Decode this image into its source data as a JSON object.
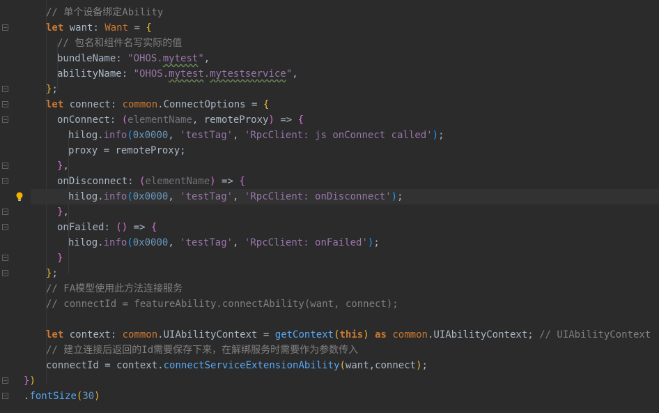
{
  "editor": {
    "lines": [
      {
        "indent": 1,
        "tokens": [
          {
            "c": "cm",
            "t": "// 单个设备绑定Ability"
          }
        ]
      },
      {
        "indent": 1,
        "tokens": [
          {
            "c": "kw",
            "t": "let"
          },
          {
            "c": "ident",
            "t": " want"
          },
          {
            "c": "pun",
            "t": ": "
          },
          {
            "c": "type",
            "t": "Want"
          },
          {
            "c": "pun",
            "t": " = "
          },
          {
            "c": "brk",
            "t": "{"
          }
        ]
      },
      {
        "indent": 2,
        "tokens": [
          {
            "c": "cm",
            "t": "// 包名和组件名写实际的值"
          }
        ]
      },
      {
        "indent": 2,
        "tokens": [
          {
            "c": "ident",
            "t": "bundleName"
          },
          {
            "c": "pun",
            "t": ": "
          },
          {
            "c": "strp",
            "t": "\"OHOS."
          },
          {
            "c": "strp squig",
            "t": "mytest"
          },
          {
            "c": "strp",
            "t": "\""
          },
          {
            "c": "pun",
            "t": ","
          }
        ]
      },
      {
        "indent": 2,
        "tokens": [
          {
            "c": "ident",
            "t": "abilityName"
          },
          {
            "c": "pun",
            "t": ": "
          },
          {
            "c": "strp",
            "t": "\"OHOS."
          },
          {
            "c": "strp squig",
            "t": "mytest"
          },
          {
            "c": "strp",
            "t": "."
          },
          {
            "c": "strp squig",
            "t": "mytestservice"
          },
          {
            "c": "strp",
            "t": "\""
          },
          {
            "c": "pun",
            "t": ","
          }
        ]
      },
      {
        "indent": 1,
        "tokens": [
          {
            "c": "brk",
            "t": "}"
          },
          {
            "c": "pun",
            "t": ";"
          }
        ]
      },
      {
        "indent": 1,
        "tokens": [
          {
            "c": "kw",
            "t": "let"
          },
          {
            "c": "ident",
            "t": " connect"
          },
          {
            "c": "pun",
            "t": ": "
          },
          {
            "c": "type",
            "t": "common"
          },
          {
            "c": "pun",
            "t": "."
          },
          {
            "c": "ident",
            "t": "ConnectOptions"
          },
          {
            "c": "pun",
            "t": " = "
          },
          {
            "c": "brk",
            "t": "{"
          }
        ]
      },
      {
        "indent": 2,
        "tokens": [
          {
            "c": "ident",
            "t": "onConnect"
          },
          {
            "c": "pun",
            "t": ": "
          },
          {
            "c": "brk2",
            "t": "("
          },
          {
            "c": "paramd",
            "t": "elementName"
          },
          {
            "c": "pun",
            "t": ", "
          },
          {
            "c": "ident",
            "t": "remoteProxy"
          },
          {
            "c": "brk2",
            "t": ")"
          },
          {
            "c": "pun",
            "t": " => "
          },
          {
            "c": "brk2",
            "t": "{"
          }
        ]
      },
      {
        "indent": 3,
        "tokens": [
          {
            "c": "ident",
            "t": "hilog"
          },
          {
            "c": "pun",
            "t": "."
          },
          {
            "c": "prop",
            "t": "info"
          },
          {
            "c": "brk3",
            "t": "("
          },
          {
            "c": "num",
            "t": "0x0000"
          },
          {
            "c": "pun",
            "t": ", "
          },
          {
            "c": "strp",
            "t": "'testTag'"
          },
          {
            "c": "pun",
            "t": ", "
          },
          {
            "c": "strp",
            "t": "'RpcClient: js onConnect called'"
          },
          {
            "c": "brk3",
            "t": ")"
          },
          {
            "c": "pun",
            "t": ";"
          }
        ]
      },
      {
        "indent": 3,
        "tokens": [
          {
            "c": "ident",
            "t": "proxy"
          },
          {
            "c": "pun",
            "t": " = "
          },
          {
            "c": "ident",
            "t": "remoteProxy"
          },
          {
            "c": "pun",
            "t": ";"
          }
        ]
      },
      {
        "indent": 2,
        "tokens": [
          {
            "c": "brk2",
            "t": "}"
          },
          {
            "c": "pun",
            "t": ","
          }
        ]
      },
      {
        "indent": 2,
        "tokens": [
          {
            "c": "ident",
            "t": "onDisconnect"
          },
          {
            "c": "pun",
            "t": ": "
          },
          {
            "c": "brk2",
            "t": "("
          },
          {
            "c": "paramd",
            "t": "elementName"
          },
          {
            "c": "brk2",
            "t": ")"
          },
          {
            "c": "pun",
            "t": " => "
          },
          {
            "c": "brk2",
            "t": "{"
          }
        ]
      },
      {
        "indent": 3,
        "current": true,
        "tokens": [
          {
            "c": "ident",
            "t": "hilog"
          },
          {
            "c": "pun",
            "t": "."
          },
          {
            "c": "prop",
            "t": "info"
          },
          {
            "c": "brk3",
            "t": "("
          },
          {
            "c": "num",
            "t": "0x0000"
          },
          {
            "c": "pun",
            "t": ", "
          },
          {
            "c": "strp",
            "t": "'testTag'"
          },
          {
            "c": "pun",
            "t": ", "
          },
          {
            "c": "strp",
            "t": "'RpcClient: onDisconnect'"
          },
          {
            "c": "brk3",
            "t": ")"
          },
          {
            "c": "pun",
            "t": ";"
          }
        ]
      },
      {
        "indent": 2,
        "tokens": [
          {
            "c": "brk2",
            "t": "}"
          },
          {
            "c": "pun",
            "t": ","
          }
        ]
      },
      {
        "indent": 2,
        "tokens": [
          {
            "c": "ident",
            "t": "onFailed"
          },
          {
            "c": "pun",
            "t": ": "
          },
          {
            "c": "brk2",
            "t": "()"
          },
          {
            "c": "pun",
            "t": " => "
          },
          {
            "c": "brk2",
            "t": "{"
          }
        ]
      },
      {
        "indent": 3,
        "tokens": [
          {
            "c": "ident",
            "t": "hilog"
          },
          {
            "c": "pun",
            "t": "."
          },
          {
            "c": "prop",
            "t": "info"
          },
          {
            "c": "brk3",
            "t": "("
          },
          {
            "c": "num",
            "t": "0x0000"
          },
          {
            "c": "pun",
            "t": ", "
          },
          {
            "c": "strp",
            "t": "'testTag'"
          },
          {
            "c": "pun",
            "t": ", "
          },
          {
            "c": "strp",
            "t": "'RpcClient: onFailed'"
          },
          {
            "c": "brk3",
            "t": ")"
          },
          {
            "c": "pun",
            "t": ";"
          }
        ]
      },
      {
        "indent": 2,
        "tokens": [
          {
            "c": "brk2",
            "t": "}"
          }
        ]
      },
      {
        "indent": 1,
        "tokens": [
          {
            "c": "brk",
            "t": "}"
          },
          {
            "c": "pun",
            "t": ";"
          }
        ]
      },
      {
        "indent": 1,
        "tokens": [
          {
            "c": "cm",
            "t": "// FA模型使用此方法连接服务"
          }
        ]
      },
      {
        "indent": 1,
        "tokens": [
          {
            "c": "cm",
            "t": "// connectId = featureAbility.connectAbility(want, connect);"
          }
        ]
      },
      {
        "indent": 0,
        "tokens": []
      },
      {
        "indent": 1,
        "tokens": [
          {
            "c": "kw",
            "t": "let"
          },
          {
            "c": "ident",
            "t": " context"
          },
          {
            "c": "pun",
            "t": ": "
          },
          {
            "c": "type",
            "t": "common"
          },
          {
            "c": "pun",
            "t": "."
          },
          {
            "c": "ident",
            "t": "UIAbilityContext"
          },
          {
            "c": "pun",
            "t": " = "
          },
          {
            "c": "fnc",
            "t": "getContext"
          },
          {
            "c": "brk",
            "t": "("
          },
          {
            "c": "kw",
            "t": "this"
          },
          {
            "c": "brk",
            "t": ")"
          },
          {
            "c": "kw",
            "t": " as "
          },
          {
            "c": "type",
            "t": "common"
          },
          {
            "c": "pun",
            "t": "."
          },
          {
            "c": "ident",
            "t": "UIAbilityContext"
          },
          {
            "c": "pun",
            "t": "; "
          },
          {
            "c": "cm",
            "t": "// UIAbilityContext"
          }
        ]
      },
      {
        "indent": 1,
        "tokens": [
          {
            "c": "cm",
            "t": "// 建立连接后返回的Id需要保存下来，在解绑服务时需要作为参数传入"
          }
        ]
      },
      {
        "indent": 1,
        "tokens": [
          {
            "c": "ident",
            "t": "connectId"
          },
          {
            "c": "pun",
            "t": " = "
          },
          {
            "c": "ident",
            "t": "context"
          },
          {
            "c": "pun",
            "t": "."
          },
          {
            "c": "fnc",
            "t": "connectServiceExtensionAbility"
          },
          {
            "c": "brk",
            "t": "("
          },
          {
            "c": "ident",
            "t": "want"
          },
          {
            "c": "pun",
            "t": ","
          },
          {
            "c": "ident",
            "t": "connect"
          },
          {
            "c": "brk",
            "t": ")"
          },
          {
            "c": "pun",
            "t": ";"
          }
        ]
      },
      {
        "indent": 0,
        "tokens": [
          {
            "c": "brk2",
            "t": "}"
          },
          {
            "c": "brk",
            "t": ")"
          }
        ]
      },
      {
        "indent": 0,
        "tokens": [
          {
            "c": "pun",
            "t": "."
          },
          {
            "c": "fnc",
            "t": "fontSize"
          },
          {
            "c": "brk",
            "t": "("
          },
          {
            "c": "num",
            "t": "30"
          },
          {
            "c": "brk",
            "t": ")"
          }
        ]
      }
    ],
    "fold_markers": [
      1,
      5,
      6,
      7,
      10,
      11,
      13,
      14,
      16,
      17,
      24,
      25
    ],
    "bulb_line": 12,
    "colors": {
      "background": "#2b2b2b",
      "current_line": "#323232",
      "keyword": "#cc7832",
      "comment": "#808080",
      "string": "#9876aa",
      "number": "#6897bb",
      "function": "#56a8f5"
    },
    "icons": {
      "fold": "fold-marker-icon",
      "bulb": "lightbulb-icon"
    }
  }
}
